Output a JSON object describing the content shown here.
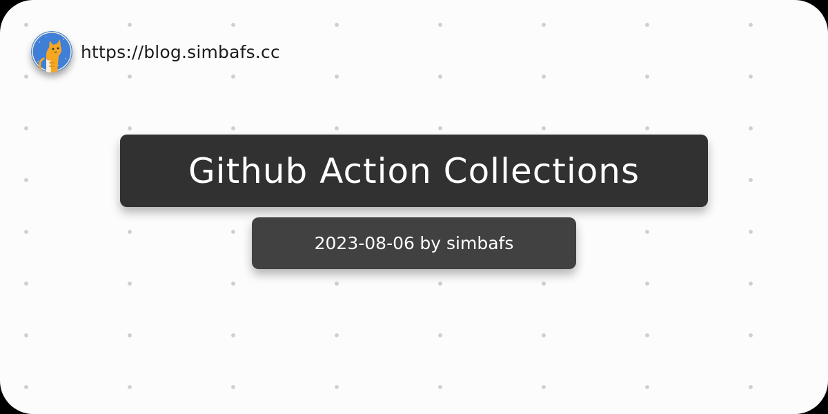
{
  "site": {
    "url": "https://blog.simbafs.cc",
    "avatar_icon": "cat-avatar-icon"
  },
  "post": {
    "title": "Github Action Collections",
    "date": "2023-08-06",
    "byline": "by simbafs"
  },
  "colors": {
    "background": "#fcfcfc",
    "dot": "#cfcfcf",
    "title_box": "#313131",
    "meta_box": "#414141",
    "avatar_background": "#3f7fd8",
    "cat": "#f5a623"
  }
}
